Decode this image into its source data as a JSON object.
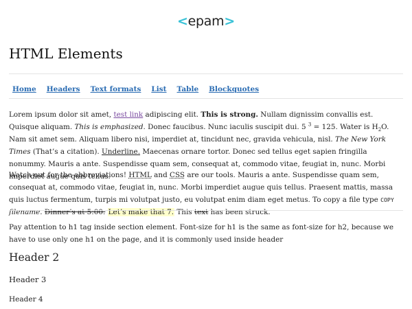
{
  "logo": {
    "left": "<",
    "text": "epam",
    "right": ">"
  },
  "title": "HTML Elements",
  "nav": [
    "Home",
    "Headers",
    "Text formats",
    "List",
    "Table",
    "Blockquotes"
  ],
  "p1": {
    "a": "Lorem ipsum dolor sit amet, ",
    "link": "test link",
    "b": " adipiscing elit. ",
    "strong": "This is strong.",
    "c": " Nullam dignissim convallis est. Quisque aliquam. ",
    "em": "This is emphasized.",
    "d": " Donec faucibus. Nunc iaculis suscipit dui. 5 ",
    "sup": "3",
    "e": " = 125. Water is H",
    "sub": "2",
    "f": "O. Nam sit amet sem. Aliquam libero nisi, imperdiet at, tincidunt nec, gravida vehicula, nisl. ",
    "cite": "The New York Times",
    "g": " (That’s a citation). ",
    "underline": "Underline.",
    "h": " Maecenas ornare tortor. Donec sed tellus eget sapien fringilla nonummy. Mauris a ante. Suspendisse quam sem, consequat at, commodo vitae, feugiat in, nunc. Morbi imperdiet augue quis tellus."
  },
  "p2": {
    "a": "Watch out for the abbreviations! ",
    "abbr1": "HTML",
    "b": " and ",
    "abbr2": "CSS",
    "c": " are our tools. Mauris a ante. Suspendisse quam sem, consequat at, commodo vitae, feugiat in, nunc. Morbi imperdiet augue quis tellus. Praesent mattis, massa quis luctus fermentum, turpis mi volutpat justo, eu volutpat enim diam eget metus. To copy a file type ",
    "code": "COPY",
    "d": " ",
    "filename": "filename.",
    "e": " ",
    "del": "Dinner’s at 5:00.",
    "f": " ",
    "mark": "Let’s make that 7.",
    "g": " This ",
    "strike": "text",
    "h": " has been struck."
  },
  "p3": "Pay attention to h1 tag inside section element. Font-size for h1 is the same as font-size for h2, because we have to use only one h1 on the page, and it is commonly used inside header",
  "h2": "Header 2",
  "h3": "Header 3",
  "h4": "Header 4"
}
